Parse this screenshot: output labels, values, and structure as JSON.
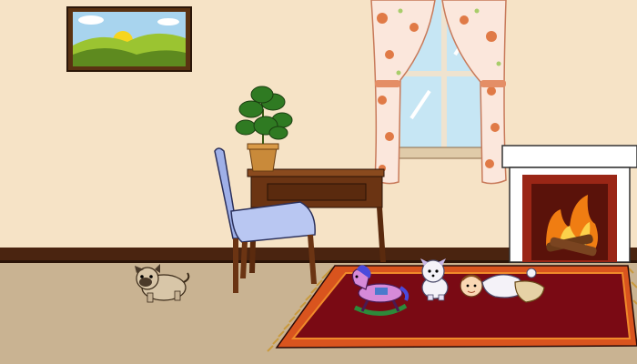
{
  "scene": {
    "name": "living-room",
    "colors": {
      "wall": "#f6e3c6",
      "floor": "#c9b392",
      "baseboard": "#4a2410",
      "rug_border": "#d9541e",
      "rug_inner": "#7a0a14",
      "fringe": "#c99a3e",
      "desk": "#6b3413",
      "chair": "#9fb0e8",
      "fireplace_brick": "#9a2616",
      "fire": "#f07d12"
    },
    "objects": [
      {
        "name": "landscape-painting",
        "icon": "painting-icon"
      },
      {
        "name": "window-with-curtains",
        "icon": "window-icon"
      },
      {
        "name": "potted-plant",
        "icon": "plant-icon"
      },
      {
        "name": "writing-desk",
        "icon": "desk-icon"
      },
      {
        "name": "blue-chair",
        "icon": "chair-icon"
      },
      {
        "name": "fireplace",
        "icon": "fire-icon"
      },
      {
        "name": "red-rug",
        "icon": "rug-icon"
      },
      {
        "name": "pug-puppy",
        "icon": "dog-icon"
      },
      {
        "name": "rocking-horse-toy",
        "icon": "horse-icon"
      },
      {
        "name": "white-puppy-toy",
        "icon": "puppy-icon"
      },
      {
        "name": "baby",
        "icon": "baby-icon"
      }
    ]
  }
}
